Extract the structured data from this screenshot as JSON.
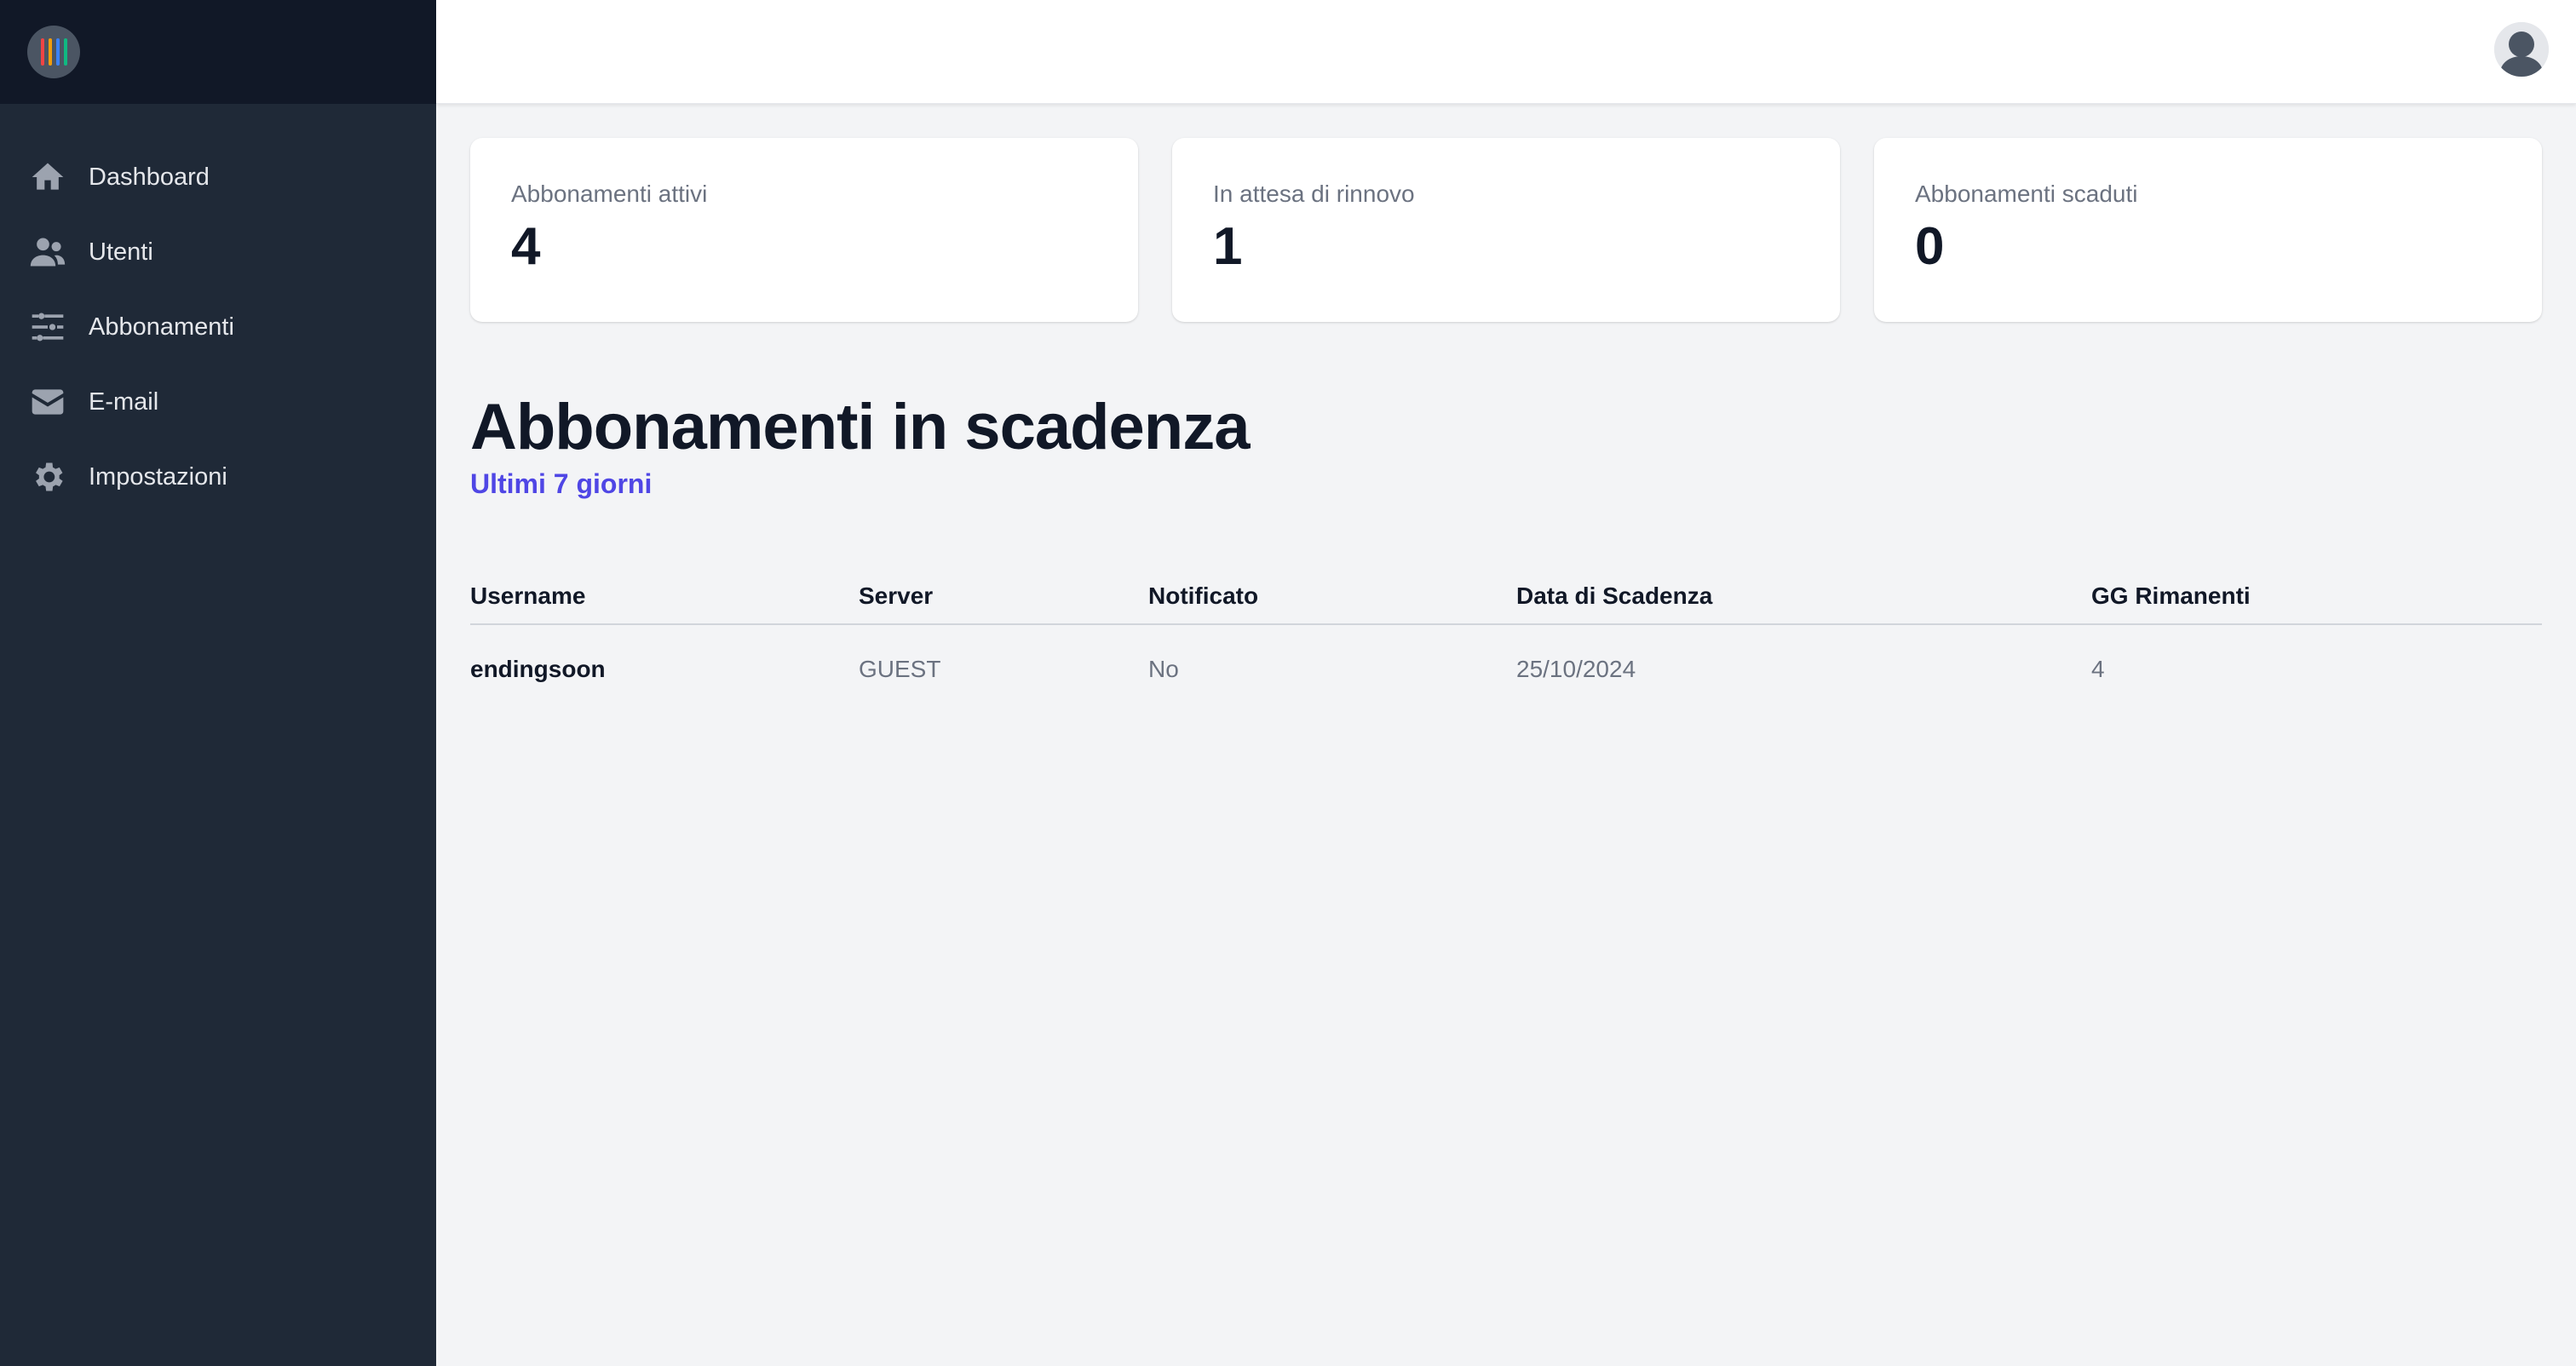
{
  "sidebar": {
    "items": [
      {
        "label": "Dashboard",
        "icon": "home-icon"
      },
      {
        "label": "Utenti",
        "icon": "users-icon"
      },
      {
        "label": "Abbonamenti",
        "icon": "sliders-icon"
      },
      {
        "label": "E-mail",
        "icon": "mail-icon"
      },
      {
        "label": "Impostazioni",
        "icon": "gear-icon"
      }
    ]
  },
  "stats": [
    {
      "label": "Abbonamenti attivi",
      "value": "4"
    },
    {
      "label": "In attesa di rinnovo",
      "value": "1"
    },
    {
      "label": "Abbonamenti scaduti",
      "value": "0"
    }
  ],
  "section": {
    "title": "Abbonamenti in scadenza",
    "subtitle": "Ultimi 7 giorni"
  },
  "table": {
    "headers": [
      "Username",
      "Server",
      "Notificato",
      "Data di Scadenza",
      "GG Rimanenti"
    ],
    "rows": [
      [
        "endingsoon",
        "GUEST",
        "No",
        "25/10/2024",
        "4"
      ]
    ]
  },
  "colors": {
    "sidebar": "#1f2937",
    "sidebar_top": "#111827",
    "accent": "#4f46e5",
    "background": "#f3f4f6"
  }
}
